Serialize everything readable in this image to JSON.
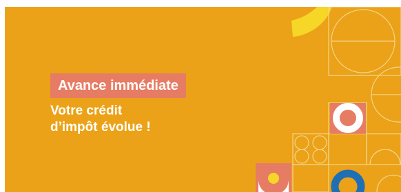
{
  "banner": {
    "badge_text": "Avance immédiate",
    "headline_line1": "Votre crédit",
    "headline_line2": "d’impôt évolue !"
  },
  "colors": {
    "background": "#eba218",
    "badge": "#e77c64",
    "text": "#ffffff",
    "yellow": "#f6d627",
    "blue": "#1f6fb5",
    "line": "#f4d58a"
  }
}
